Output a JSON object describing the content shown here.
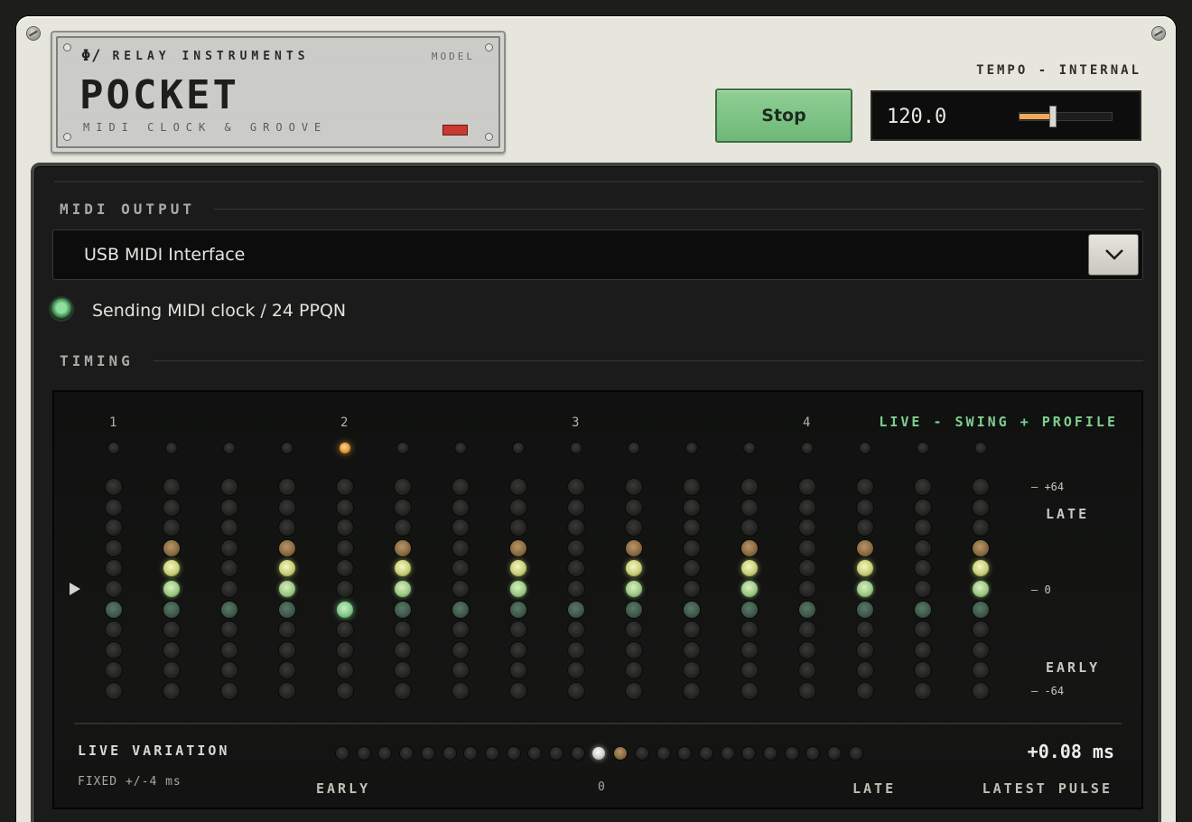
{
  "header": {
    "logo": "Φ/",
    "brand": "RELAY INSTRUMENTS",
    "model_label": "MODEL",
    "product": "POCKET",
    "tagline": "MIDI CLOCK & GROOVE"
  },
  "transport": {
    "stop_label": "Stop",
    "tempo_label": "TEMPO - INTERNAL",
    "tempo_value": "120.0",
    "tempo_slider_fraction": 0.36
  },
  "midi_output": {
    "section_label": "MIDI OUTPUT",
    "selected_device": "USB MIDI Interface",
    "status": "Sending MIDI clock / 24 PPQN",
    "status_color": "#7fd68f"
  },
  "timing": {
    "section_label": "TIMING",
    "beat_numbers": [
      "1",
      "2",
      "3",
      "4"
    ],
    "mode_label": "LIVE - SWING + PROFILE",
    "current_step": 5,
    "scale": {
      "top": "+64",
      "mid": "0",
      "bottom": "-64",
      "late": "LATE",
      "early": "EARLY"
    },
    "columns": [
      {
        "lit": {
          "6": "teal"
        }
      },
      {
        "lit": {
          "3": "brown",
          "4": "lemon",
          "5": "green",
          "6": "teal"
        }
      },
      {
        "lit": {
          "6": "teal"
        }
      },
      {
        "lit": {
          "3": "brown",
          "4": "lemon",
          "5": "green",
          "6": "teal"
        }
      },
      {
        "lit": {
          "6": "bright"
        }
      },
      {
        "lit": {
          "3": "brown",
          "4": "lemon",
          "5": "green",
          "6": "teal"
        }
      },
      {
        "lit": {
          "6": "teal"
        }
      },
      {
        "lit": {
          "3": "brown",
          "4": "lemon",
          "5": "green",
          "6": "teal"
        }
      },
      {
        "lit": {
          "6": "teal"
        }
      },
      {
        "lit": {
          "3": "brown",
          "4": "lemon",
          "5": "green",
          "6": "teal"
        }
      },
      {
        "lit": {
          "6": "teal"
        }
      },
      {
        "lit": {
          "3": "brown",
          "4": "lemon",
          "5": "green",
          "6": "teal"
        }
      },
      {
        "lit": {
          "6": "teal"
        }
      },
      {
        "lit": {
          "3": "brown",
          "4": "lemon",
          "5": "green",
          "6": "teal"
        }
      },
      {
        "lit": {
          "6": "teal"
        }
      },
      {
        "lit": {
          "3": "brown",
          "4": "lemon",
          "5": "green",
          "6": "teal"
        }
      }
    ]
  },
  "live_variation": {
    "title": "LIVE VARIATION",
    "fixed": "FIXED +/-4 ms",
    "value": "+0.08 ms",
    "value_caption": "LATEST PULSE",
    "early": "EARLY",
    "zero": "0",
    "late": "LATE",
    "led_count": 25,
    "white_index": 12,
    "brown_index": 13
  },
  "colors": {
    "orange": "#e59a3c",
    "brown": "#8a6b42",
    "lemon": "#c9cf7a",
    "green": "#9ec986",
    "teal": "#3f5a4a",
    "bright": "#83c98d",
    "stop_button": "#7cc284"
  }
}
